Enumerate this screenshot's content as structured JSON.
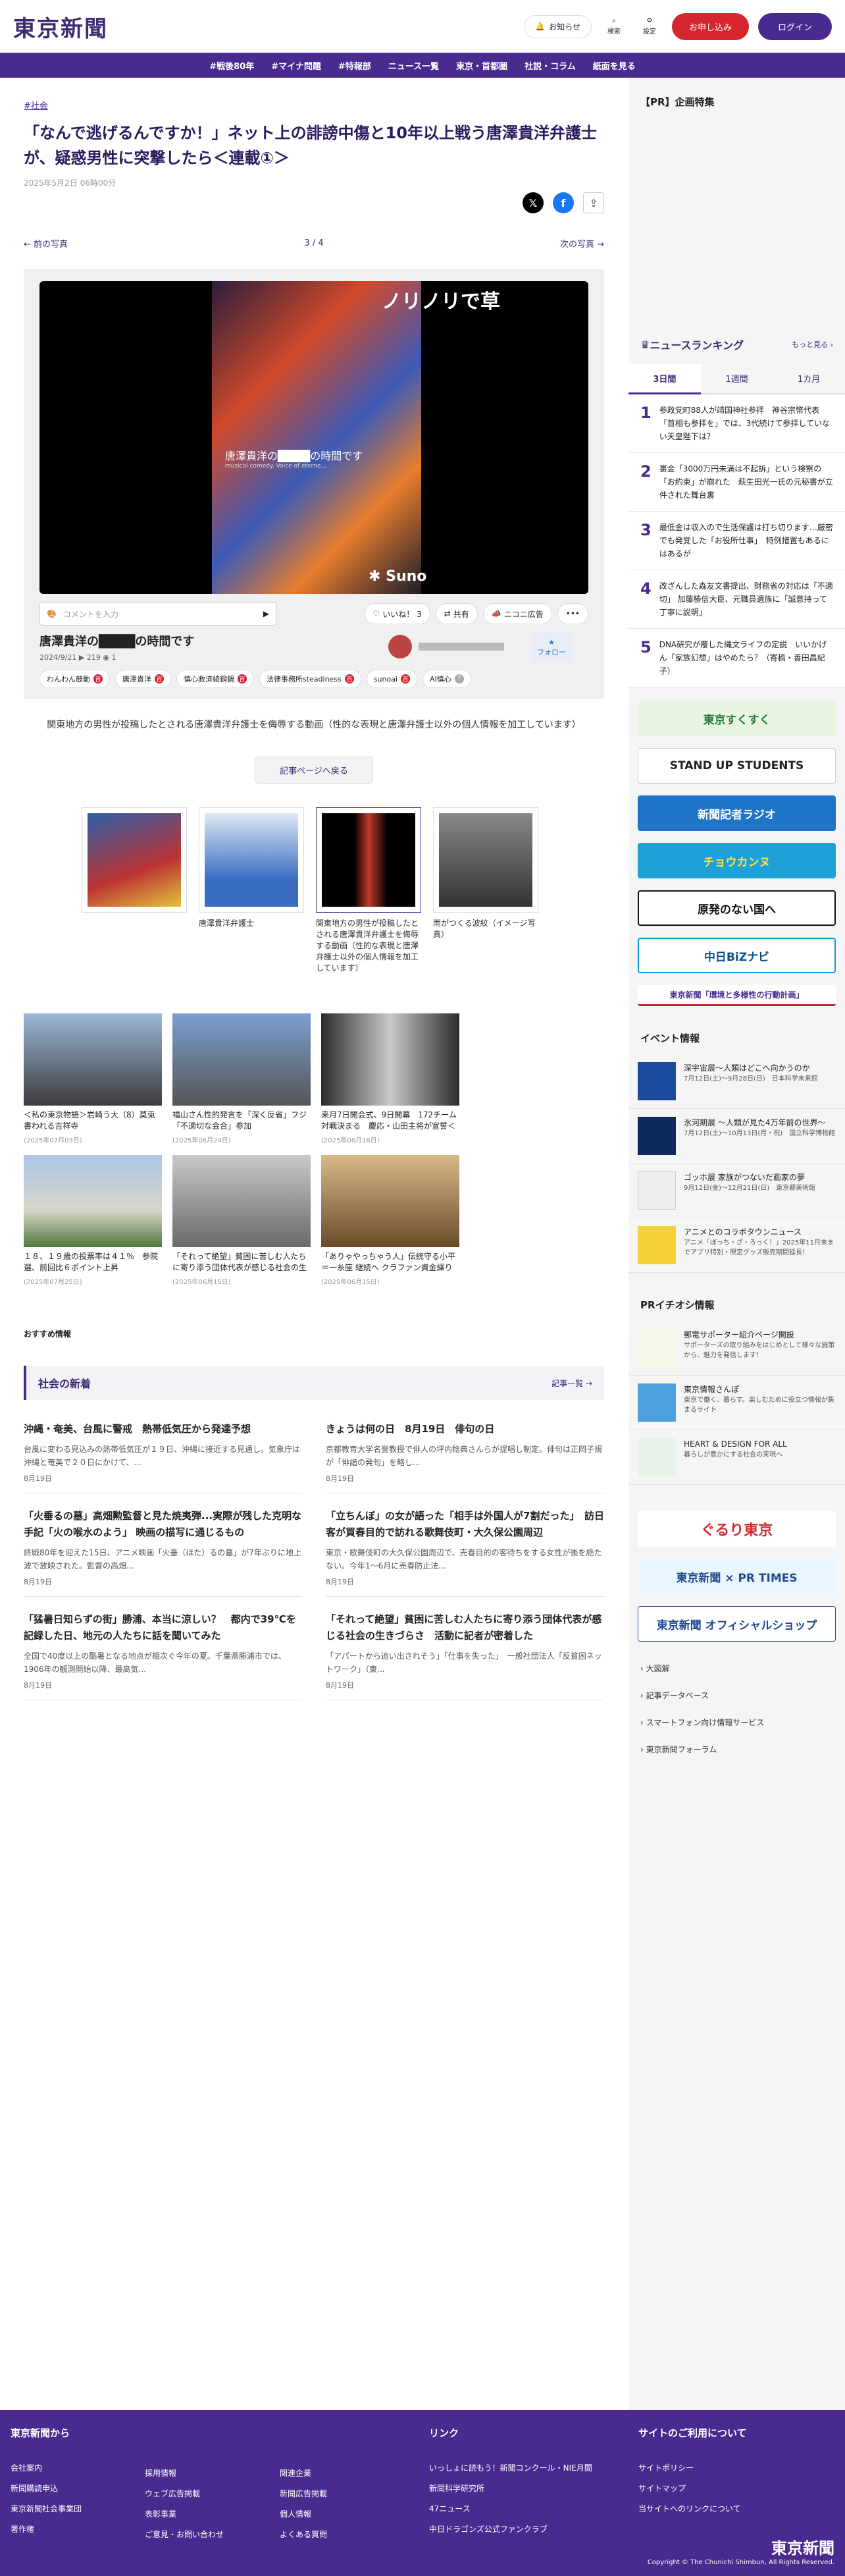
{
  "header": {
    "logo": "東京新聞",
    "notice": "お知らせ",
    "search": "検索",
    "settings": "設定",
    "subscribe": "お申し込み",
    "login": "ログイン"
  },
  "nav": [
    "#戦後80年",
    "#マイナ問題",
    "#特報部",
    "ニュース一覧",
    "東京・首都圏",
    "社説・コラム",
    "紙面を見る"
  ],
  "article": {
    "tag": "#社会",
    "title": "「なんで逃げるんですか！」ネット上の誹謗中傷と10年以上戦う唐澤貴洋弁護士が、疑惑男性に突撃したら＜連載①＞",
    "date": "2025年5月2日 06時00分",
    "prev": "前の写真",
    "next": "次の写真",
    "counter": "3 / 4",
    "video": {
      "song": "ノリノリで草",
      "art_caption": "唐澤貴洋の",
      "art_caption2": "の時間です",
      "art_sub": "musical comedy. Voice of eterne...",
      "brand": "Suno",
      "comment_placeholder": "コメントを入力",
      "like": "いいね！ 3",
      "share": "共有",
      "niconico": "ニコニ広告",
      "title_a": "唐澤貴洋の",
      "title_b": "の時間です",
      "meta": "2024/9/21  ▶ 219  ◉ 1",
      "follow": "フォロー",
      "chips": [
        "わんわん鼓動",
        "唐澤貴洋",
        "慎心救済綾鋼鍋",
        "法律事務所steadiness",
        "sunoai",
        "AI慎心"
      ]
    },
    "caption": "関東地方の男性が投稿したとされる唐澤貴洋弁護士を侮辱する動画（性的な表現と唐澤弁護士以外の個人情報を加工しています）",
    "back": "記事ページへ戻る",
    "thumbs": [
      {
        "cap": ""
      },
      {
        "cap": "唐澤貴洋弁護士"
      },
      {
        "cap": "関東地方の男性が投稿したとされる唐澤貴洋弁護士を侮辱する動画（性的な表現と唐澤弁護士以外の個人情報を加工しています）"
      },
      {
        "cap": "雨がつくる波紋（イメージ写真）"
      }
    ]
  },
  "related": [
    {
      "t": "＜私の東京物語＞岩崎う大（8）莫兎書われる吉祥寺",
      "d": "(2025年07月03日)"
    },
    {
      "t": "福山さん性的発言を「深く反省」フジ「不適切な会合」参加",
      "d": "(2025年06月24日)"
    },
    {
      "t": "来月7日開会式、9日開幕　172チーム対戦決まる　慶応・山田主将が宣誓＜国民野球・神奈...",
      "d": "(2025年06月16日)"
    },
    {
      "t": "１８、１９歳の投票率は４１％　参院選、前回比６ポイント上昇",
      "d": "(2025年07月25日)"
    },
    {
      "t": "「それって絶望」貧困に苦しむ人たちに寄り添う団体代表が感じる社会の生きづらさ　活動...",
      "d": "(2025年06月15日)"
    },
    {
      "t": "「ありゃやっちゃう人」伝統守る小平＝一糸座 継続へ クラファン資金繰り費化...新作公演につ...",
      "d": "(2025年06月15日)"
    }
  ],
  "recommend": "おすすめ情報",
  "latest": {
    "title": "社会の新着",
    "more": "記事一覧",
    "items": [
      {
        "t": "沖縄・奄美、台風に警戒　熱帯低気圧から発達予想",
        "p": "台風に変わる見込みの熱帯低気圧が１９日、沖縄に接近する見通し。気象庁は沖縄と奄美で２０日にかけて、...",
        "d": "8月19日"
      },
      {
        "t": "きょうは何の日　8月19日　俳句の日",
        "p": "京都教育大学名誉教授で俳人の坪内稔典さんらが提唱し制定。俳句は正岡子規が「俳諧の発句」を略し...",
        "d": "8月19日"
      },
      {
        "t": "「火垂るの墓」高畑勲監督と見た焼夷弾...実際が残した克明な手記「火の喉水のよう」 映画の描写に通じるもの",
        "p": "終戦80年を迎えた15日、アニメ映画「火垂（ほた）るの墓」が7年ぶりに地上波で放映された。監督の高畑...",
        "d": "8月19日"
      },
      {
        "t": "「立ちんぼ」の女が語った「相手は外国人が7割だった」　訪日客が買春目的で訪れる歌舞伎町・大久保公園周辺",
        "p": "東京・歌舞伎町の大久保公園周辺で、売春目的の客待ちをする女性が後を絶たない。今年1～6月に売春防止法...",
        "d": "8月19日"
      },
      {
        "t": "「猛暑日知らずの街」勝浦、本当に涼しい？　都内で39℃を記録した日、地元の人たちに話を聞いてみた",
        "p": "全国で40度以上の酷暑となる地点が相次ぐ今年の夏。千葉県勝浦市では、1906年の観測開始以降、最高気...",
        "d": "8月19日"
      },
      {
        "t": "「それって絶望」貧困に苦しむ人たちに寄り添う団体代表が感じる社会の生きづらさ　活動に記者が密着した",
        "p": "「アパートから追い出されそう」「仕事を失った」　一般社団法人「反貧困ネットワーク」（東...",
        "d": "8月19日"
      }
    ]
  },
  "side": {
    "pr_title": "【PR】企画特集",
    "rank_title": "ニュースランキング",
    "rank_more": "もっと見る",
    "tabs": [
      "3日間",
      "1週間",
      "1カ月"
    ],
    "rank": [
      "参政党町88人が靖国神社参拝　神谷宗幣代表「首相も参拝を」では、3代続けて参拝していない天皇陛下は？",
      "裏金「3000万円未満は不起訴」という検察の「お約束」が崩れた　萩生田光一氏の元秘書が立件された舞台裏",
      "最低金は収入ので生活保護は打ち切ります…厳密でも発覚した「お役所仕事」　特例措置もあるにはあるが",
      "改ざんした森友文書提出、財務省の対応は「不適切」 加藤勝信大臣、元職員遺族に「誠意持って丁寧に説明」",
      "DNA研究が覆した縄文ライフの定説　いいかげん「家族幻想」はやめたら？（寄稿・善田昌紀子）"
    ],
    "banners": [
      "東京すくすく",
      "STAND UP STUDENTS",
      "新聞記者ラジオ",
      "チョウカンヌ",
      "原発のない国へ",
      "中日BiZナビ",
      "東京新聞「環境と多様性の行動計画」"
    ],
    "event_title": "イベント情報",
    "events": [
      {
        "t": "深宇宙展～人類はどこへ向かうのか",
        "s": "7月12日(土)～9月28日(日)　日本科学未来館"
      },
      {
        "t": "氷河期展 ～人類が見た4万年前の世界～",
        "s": "7月12日(土)～10月13日(月・祝)　国立科学博物館"
      },
      {
        "t": "ゴッホ展 家族がつないだ画家の夢",
        "s": "9月12日(金)～12月21日(日)　東京都美術館"
      },
      {
        "t": "アニメとのコラボタウンニュース",
        "s": "アニメ「ぼっち・ざ・ろっく！」2025年11月末までアプリ特別・限定グッズ販売期間延長！"
      }
    ],
    "pr_title2": "PRイチオシ情報",
    "prs": [
      {
        "t": "郵電サポーター紹介ページ開設",
        "s": "サポーターズの取り組みをはじめとして様々な施策から、魅力を発信します！"
      },
      {
        "t": "東京情報さんぽ",
        "s": "東京で働く、暮らす。楽しむために役立つ情報が集まるサイト"
      },
      {
        "t": "HEART & DESIGN FOR ALL",
        "s": "暮らしが豊かにする社会の実現へ"
      }
    ],
    "logos": [
      "ぐるり東京",
      "東京新聞 × PR TIMES",
      "東京新聞 オフィシャルショップ"
    ],
    "links": [
      "大図解",
      "記事データベース",
      "スマートフォン向け情報サービス",
      "東京新聞フォーラム"
    ]
  },
  "footer": {
    "col1_title": "東京新聞から",
    "col1": [
      "会社案内",
      "新聞購読申込",
      "東京新聞社会事業団",
      "著作権"
    ],
    "col2": [
      "採用情報",
      "ウェブ広告掲載",
      "表彰事業",
      "ご意見・お問い合わせ"
    ],
    "col3": [
      "関連企業",
      "新聞広告掲載",
      "個人情報",
      "よくある質問"
    ],
    "col4_title": "リンク",
    "col4": [
      "いっしょに読もう！新聞コンクール・NIE月間",
      "新聞科学研究所",
      "47ニュース",
      "中日ドラゴンズ公式ファンクラブ"
    ],
    "col5_title": "サイトのご利用について",
    "col5": [
      "サイトポリシー",
      "サイトマップ",
      "当サイトへのリンクについて"
    ],
    "logo": "東京新聞",
    "copyright": "Copyright © The Chunichi Shimbun, All Rights Reserved."
  }
}
